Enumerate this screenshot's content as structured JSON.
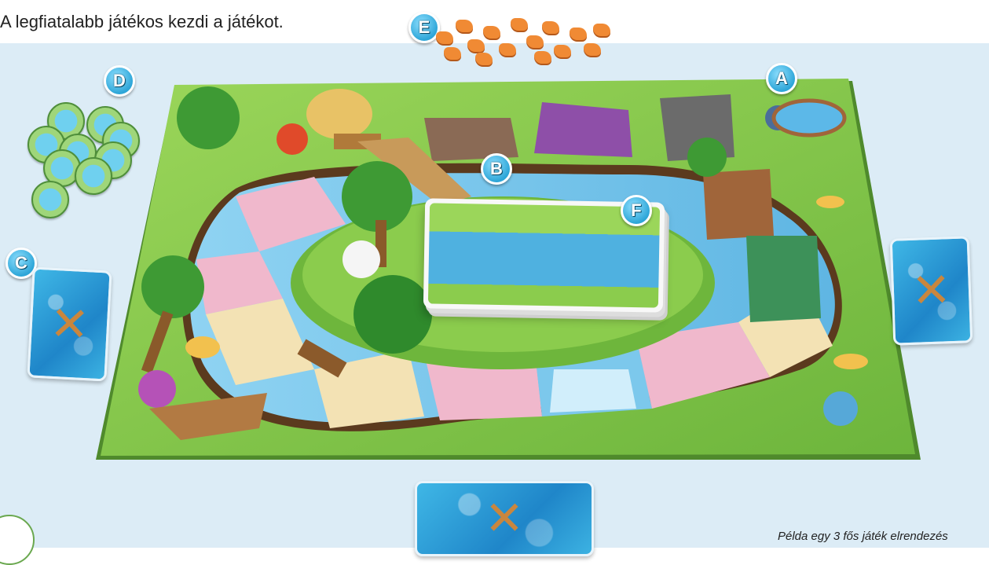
{
  "header": {
    "instruction": "A legfiatalabb játékos kezdi a játékot."
  },
  "caption": "Példa egy 3 fős játék elrendezés",
  "markers": {
    "a": "A",
    "b": "B",
    "c": "C",
    "d": "D",
    "e": "E",
    "f": "F"
  },
  "colors": {
    "background": "#dcecf6",
    "grass": "#7cc447",
    "water_blue": "#7cc8ec",
    "water_pink": "#f0b8cc",
    "sand": "#f3e2b4",
    "marker": "#2ea6d8",
    "meeple": "#f08a34"
  },
  "icons": {
    "paddle": "crossed-paddles-icon",
    "token": "water-token-icon"
  }
}
